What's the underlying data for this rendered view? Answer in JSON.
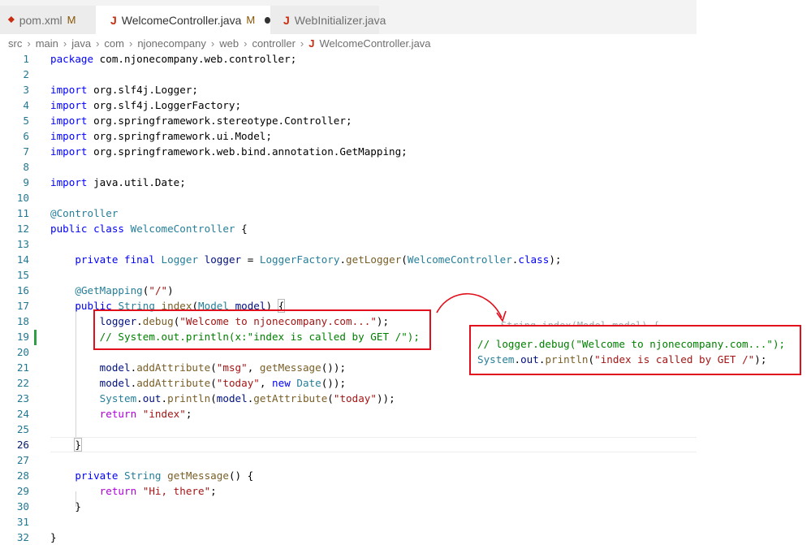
{
  "tabs": [
    {
      "icon": "maven-icon",
      "label": "pom.xml",
      "mod": "M"
    },
    {
      "icon": "java-icon",
      "label": "WelcomeController.java",
      "mod": "M"
    },
    {
      "icon": "java-icon",
      "label": "WebInitializer.java"
    }
  ],
  "breadcrumb": [
    "src",
    "main",
    "java",
    "com",
    "njonecompany",
    "web",
    "controller",
    "WelcomeController.java"
  ],
  "line_numbers": [
    "1",
    "2",
    "3",
    "4",
    "5",
    "6",
    "7",
    "8",
    "9",
    "10",
    "11",
    "12",
    "13",
    "14",
    "15",
    "16",
    "17",
    "18",
    "19",
    "20",
    "21",
    "22",
    "23",
    "24",
    "25",
    "26",
    "27",
    "28",
    "29",
    "30",
    "31",
    "32"
  ],
  "code": {
    "l1": {
      "kw": "package",
      "rest": " com.njonecompany.web.controller;"
    },
    "l3": {
      "kw": "import",
      "rest": " org.slf4j.Logger;"
    },
    "l4": {
      "kw": "import",
      "rest": " org.slf4j.LoggerFactory;"
    },
    "l5": {
      "kw": "import",
      "rest": " org.springframework.stereotype.Controller;"
    },
    "l6": {
      "kw": "import",
      "rest": " org.springframework.ui.Model;"
    },
    "l7": {
      "kw": "import",
      "rest": " org.springframework.web.bind.annotation.GetMapping;"
    },
    "l9": {
      "kw": "import",
      "rest": " java.util.Date;"
    },
    "l11": {
      "at": "@",
      "ann": "Controller"
    },
    "l12": {
      "kw1": "public",
      "kw2": "class",
      "ty": "WelcomeController",
      "rest": " {"
    },
    "l14": {
      "kw1": "private",
      "kw2": "final",
      "ty": "Logger",
      "var": "logger",
      "eq": " = ",
      "ty2": "LoggerFactory",
      "dot": ".",
      "fn": "getLogger",
      "p1": "(",
      "ty3": "WelcomeController",
      "p2": ".",
      "kw3": "class",
      "p3": ");"
    },
    "l16": {
      "at": "@",
      "ann": "GetMapping",
      "p1": "(",
      "str": "\"/\"",
      "p2": ")"
    },
    "l17": {
      "kw": "public",
      "ty": "String",
      "fn": "index",
      "p1": "(",
      "ty2": "Model",
      "var": "model",
      "p2": ")",
      "brace": "{"
    },
    "l18": {
      "var": "logger",
      "dot": ".",
      "fn": "debug",
      "p1": "(",
      "str": "\"Welcome to njonecompany.com...\"",
      "p2": ");"
    },
    "l19": {
      "cm": "// System.out.println(x:\"index is called by GET /\");"
    },
    "l21": {
      "var": "model",
      "dot": ".",
      "fn": "addAttribute",
      "p1": "(",
      "str": "\"msg\"",
      "c": ", ",
      "fn2": "getMessage",
      "p2": "());"
    },
    "l22": {
      "var": "model",
      "dot": ".",
      "fn": "addAttribute",
      "p1": "(",
      "str": "\"today\"",
      "c": ", ",
      "kw": "new",
      "ty": "Date",
      "p2": "());"
    },
    "l23": {
      "ty": "System",
      "dot": ".",
      "var": "out",
      "dot2": ".",
      "fn": "println",
      "p1": "(",
      "var2": "model",
      "dot3": ".",
      "fn2": "getAttribute",
      "p2": "(",
      "str": "\"today\"",
      "p3": "));"
    },
    "l24": {
      "kw": "return",
      "str": "\"index\"",
      "p": ";"
    },
    "l26": {
      "brace": "}"
    },
    "l28": {
      "kw": "private",
      "ty": "String",
      "fn": "getMessage",
      "p": "() {"
    },
    "l29": {
      "kw": "return",
      "str": "\"Hi, there\"",
      "p": ";"
    },
    "l30": {
      "brace": "}"
    },
    "l32": {
      "brace": "}"
    }
  },
  "snippet": {
    "cut": "    String index(Model model) {",
    "cm": "// logger.debug(\"Welcome to njonecompany.com...\");",
    "ty": "System",
    "dot": ".",
    "var": "out",
    "dot2": ".",
    "fn": "println",
    "p1": "(",
    "str": "\"index is called by GET /\"",
    "p2": ");"
  },
  "colors": {
    "highlight_box": "#e2101d",
    "arrow": "#e2101d",
    "keyword": "#0000ff",
    "type": "#267f99",
    "string": "#a31515",
    "comment": "#008000"
  }
}
